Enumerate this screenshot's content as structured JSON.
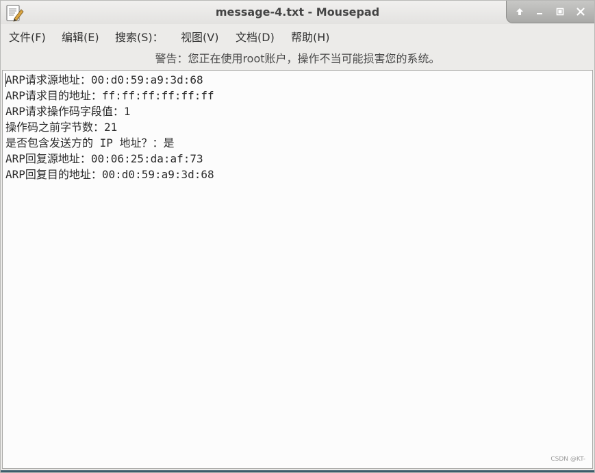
{
  "window": {
    "title": "message-4.txt - Mousepad",
    "app_icon": "text-editor-icon"
  },
  "window_controls": {
    "shade_icon": "arrow-up-icon",
    "minimize_icon": "minimize-icon",
    "maximize_icon": "maximize-icon",
    "close_icon": "close-icon"
  },
  "menubar": {
    "items": [
      {
        "label": "文件(F)"
      },
      {
        "label": "编辑(E)"
      },
      {
        "label": "搜索(S)："
      },
      {
        "label": "视图(V)"
      },
      {
        "label": "文档(D)"
      },
      {
        "label": "帮助(H)"
      }
    ]
  },
  "warning": "警告：您正在使用root账户，操作不当可能损害您的系统。",
  "editor": {
    "lines": [
      "ARP请求源地址：00:d0:59:a9:3d:68",
      "ARP请求目的地址：ff:ff:ff:ff:ff:ff",
      "ARP请求操作码字段值：1",
      "操作码之前字节数：21",
      "是否包含发送方的 IP 地址？：是",
      "ARP回复源地址：00:06:25:da:af:73",
      "ARP回复目的地址：00:d0:59:a9:3d:68"
    ]
  },
  "watermark": "CSDN @KT-",
  "colors": {
    "editor_bg": "#fcfcfc",
    "window_bg": "#ecebe9",
    "title_text": "#444444"
  }
}
